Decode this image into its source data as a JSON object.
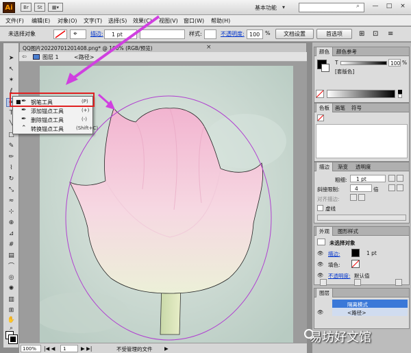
{
  "titlebar": {
    "app_logo": "Ai",
    "workspace": "基本功能",
    "icons": [
      "bridge-icon",
      "stock-icon",
      "arrange-icon"
    ],
    "window_buttons": [
      "—",
      "□",
      "×"
    ]
  },
  "menu": [
    "文件(F)",
    "编辑(E)",
    "对象(O)",
    "文字(T)",
    "选择(S)",
    "效果(C)",
    "视图(V)",
    "窗口(W)",
    "帮助(H)"
  ],
  "control": {
    "selection": "未选择对象",
    "stroke_label": "描边:",
    "stroke_weight": "1 pt",
    "style_label": "样式:",
    "opacity_label": "不透明度:",
    "opacity_value": "100",
    "opacity_unit": "%",
    "doc_setup": "文档设置",
    "preferences": "首选项"
  },
  "document": {
    "tab_title": "QQ图片20220701201408.png* @ 100% (RGB/预览)",
    "layer": "图层 1",
    "path": "<路径>"
  },
  "flyout": {
    "items": [
      {
        "label": "钢笔工具",
        "key": "(P)",
        "icon": "pen-icon",
        "active": true
      },
      {
        "label": "添加锚点工具",
        "key": "(+)",
        "icon": "add-anchor-icon",
        "active": false
      },
      {
        "label": "删除锚点工具",
        "key": "(-)",
        "icon": "delete-anchor-icon",
        "active": false
      },
      {
        "label": "转换锚点工具",
        "key": "(Shift+C)",
        "icon": "convert-anchor-icon",
        "active": false
      }
    ]
  },
  "status": {
    "zoom": "100%",
    "page": "1",
    "message": "不受管理的文件"
  },
  "panels": {
    "color": {
      "tabs": [
        "颜色",
        "颜色参考"
      ],
      "channel": "T",
      "value": "100",
      "unit": "%",
      "swatch_name": "[套版色]"
    },
    "swatches": {
      "tabs": [
        "色板",
        "画笔",
        "符号"
      ]
    },
    "stroke": {
      "tabs": [
        "描边",
        "渐变",
        "透明度"
      ],
      "weight_label": "粗细:",
      "weight_value": "1 pt",
      "miter_label": "斜接限制:",
      "miter_value": "4",
      "miter_unit": "倍",
      "align_label": "对齐描边:",
      "dashed_label": "虚线"
    },
    "appearance": {
      "tabs": [
        "外观",
        "图形样式"
      ],
      "title": "未选择对象",
      "stroke_label": "描边:",
      "stroke_value": "1 pt",
      "fill_label": "填色:",
      "opacity_label": "不透明度:",
      "opacity_value": "默认值"
    },
    "layers": {
      "tabs": [
        "图层"
      ],
      "layer_name": "隔离模式",
      "sublayer_name": "<路径>"
    }
  },
  "watermark": "易坊好文馆",
  "colors": {
    "highlight_box": "#e02020",
    "arrow": "#d040e0",
    "path_stroke": "#8a3fb8"
  }
}
